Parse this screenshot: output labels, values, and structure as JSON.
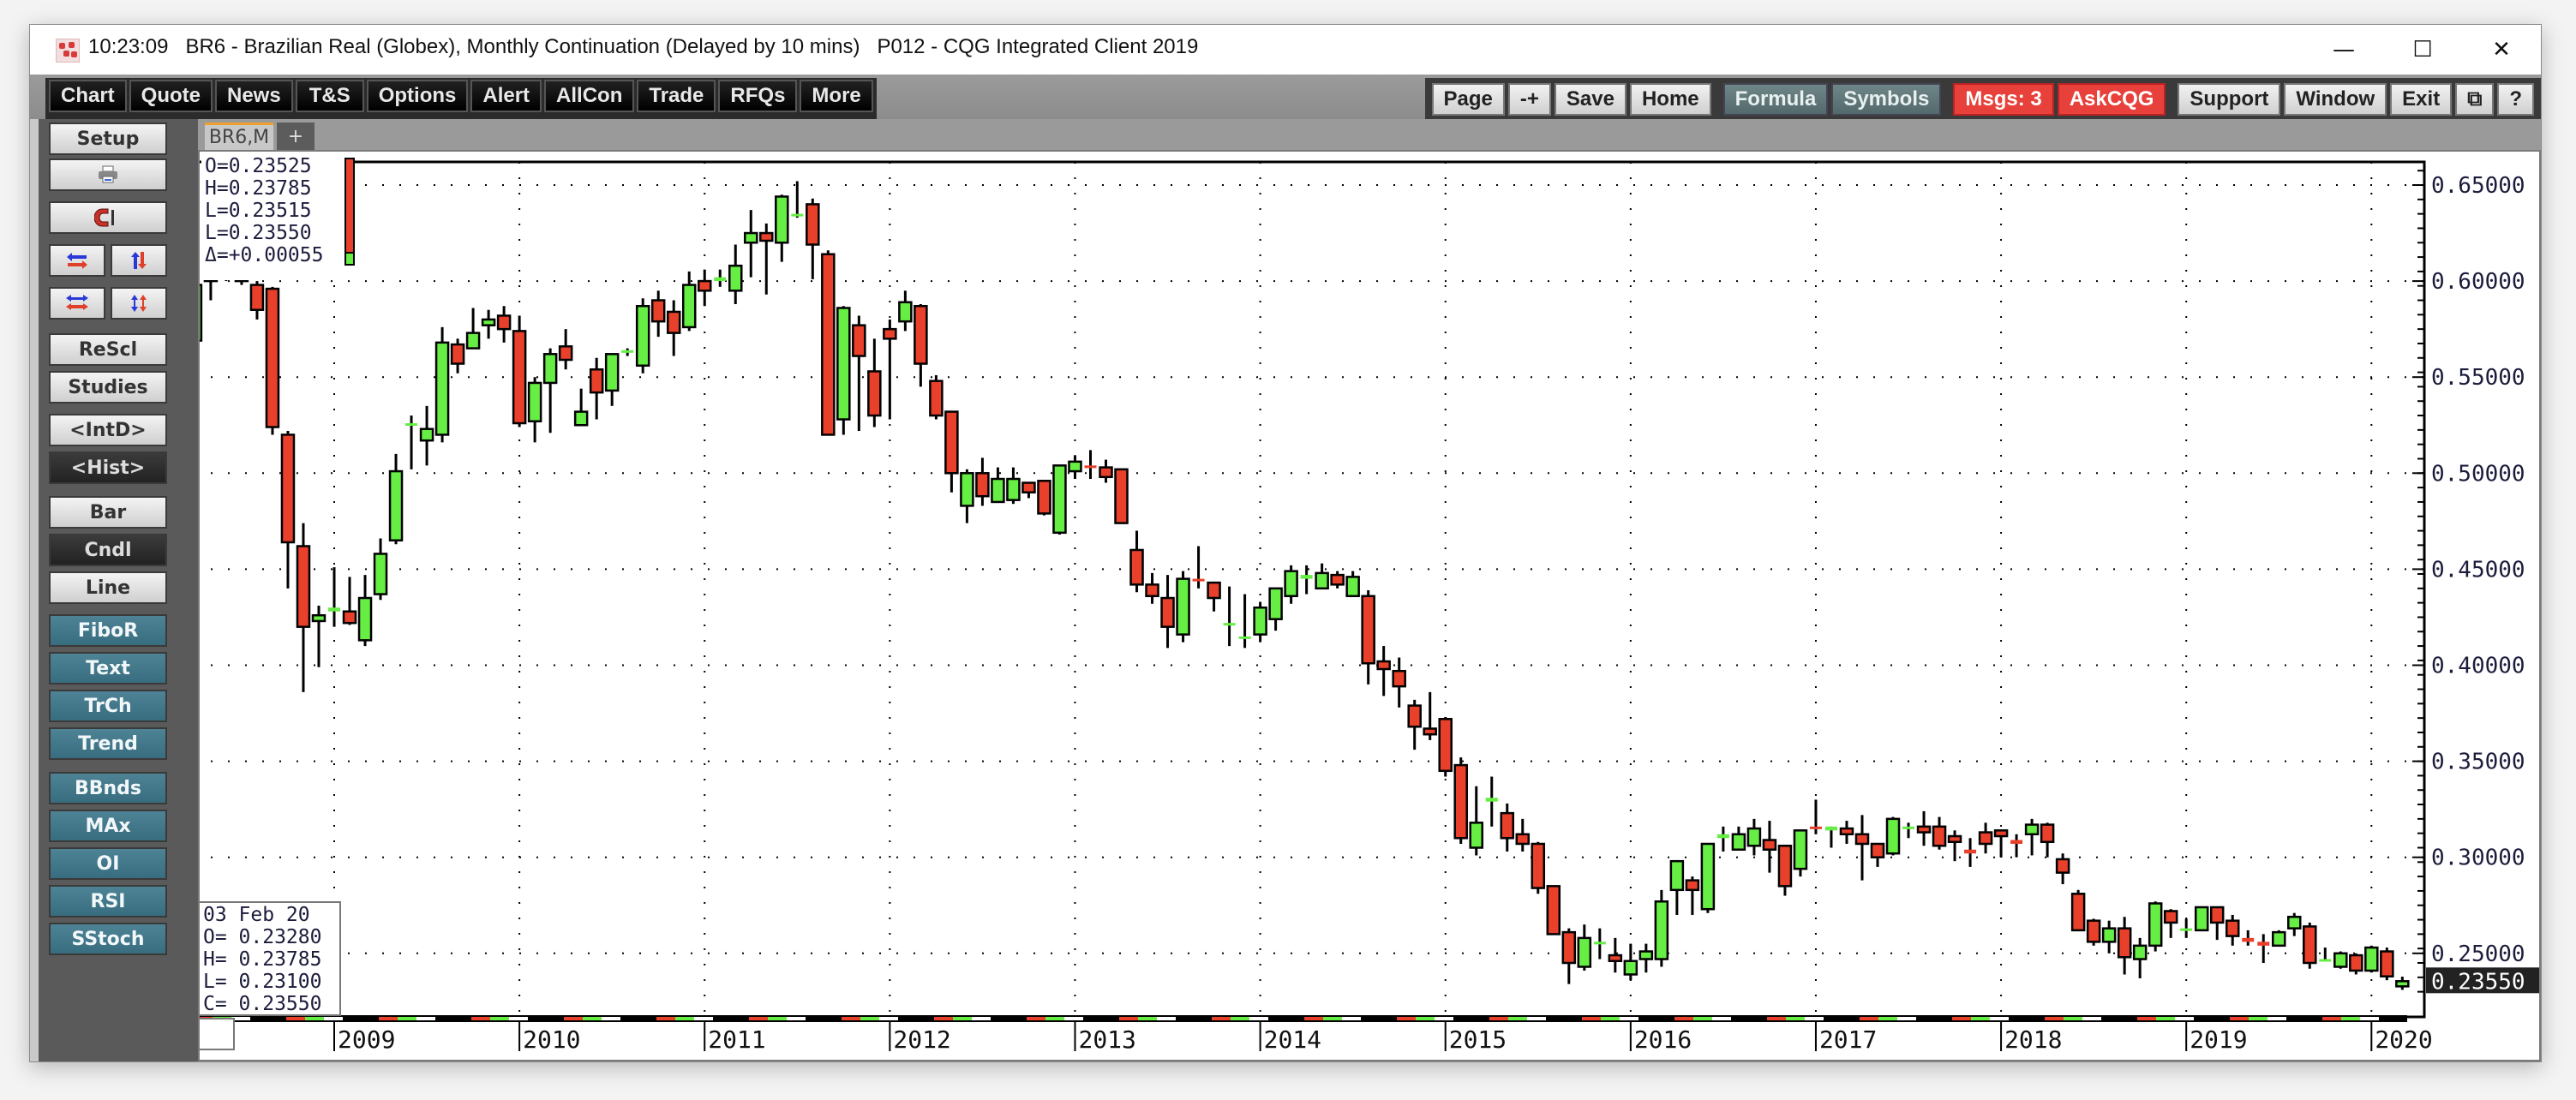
{
  "window": {
    "time": "10:23:09",
    "title": "BR6 - Brazilian Real (Globex), Monthly Continuation (Delayed by 10 mins)   P012 - CQG Integrated Client 2019",
    "controls": {
      "minimize": "—",
      "maximize": "☐",
      "close": "✕"
    }
  },
  "toolbar": {
    "left": [
      "Chart",
      "Quote",
      "News",
      "T&S",
      "Options",
      "Alert",
      "AllCon",
      "Trade",
      "RFQs",
      "More"
    ],
    "right": [
      {
        "label": "Page",
        "style": "light"
      },
      {
        "label": "-+",
        "style": "light"
      },
      {
        "label": "Save",
        "style": "light"
      },
      {
        "label": "Home",
        "style": "light"
      },
      {
        "label": "Formula",
        "style": "slate"
      },
      {
        "label": "Symbols",
        "style": "slate"
      },
      {
        "label": "Msgs: 3",
        "style": "red"
      },
      {
        "label": "AskCQG",
        "style": "red"
      },
      {
        "label": "Support",
        "style": "light"
      },
      {
        "label": "Window",
        "style": "light"
      },
      {
        "label": "Exit",
        "style": "light"
      },
      {
        "label": "⧉",
        "style": "light"
      },
      {
        "label": "?",
        "style": "light"
      }
    ]
  },
  "sidebar": {
    "setup": "Setup",
    "print_icon": "printer-icon",
    "magnet_icon": "magnet-icon",
    "icon_pairs": [
      [
        "scroll-horizontal-icon",
        "scroll-vertical-icon"
      ],
      [
        "compress-horizontal-icon",
        "compress-vertical-icon"
      ]
    ],
    "buttons": [
      {
        "label": "ReScl",
        "style": "light"
      },
      {
        "label": "Studies",
        "style": "light"
      },
      {
        "label": "<IntD>",
        "style": "light"
      },
      {
        "label": "<Hist>",
        "style": "dark"
      },
      {
        "label": "Bar",
        "style": "light"
      },
      {
        "label": "Cndl",
        "style": "dark"
      },
      {
        "label": "Line",
        "style": "light"
      },
      {
        "label": "FiboR",
        "style": "teal"
      },
      {
        "label": "Text",
        "style": "teal"
      },
      {
        "label": "TrCh",
        "style": "teal"
      },
      {
        "label": "Trend",
        "style": "teal"
      },
      {
        "label": "BBnds",
        "style": "teal"
      },
      {
        "label": "MAx",
        "style": "teal"
      },
      {
        "label": "OI",
        "style": "teal"
      },
      {
        "label": "RSI",
        "style": "teal"
      },
      {
        "label": "SStoch",
        "style": "teal"
      }
    ]
  },
  "tabs": {
    "active": "BR6,M",
    "add": "+"
  },
  "readout_top": [
    "O=0.23525",
    "H=0.23785",
    "L=0.23515",
    "L=0.23550",
    "Δ=+0.00055"
  ],
  "readout_bottom": [
    "03 Feb 20",
    "O= 0.23280",
    "H= 0.23785",
    "L= 0.23100",
    "C= 0.23550"
  ],
  "colors": {
    "up": "#66ee44",
    "down": "#e8402a",
    "last_price_bg": "#222222"
  },
  "chart_data": {
    "type": "candlestick",
    "title": "BR6 - Brazilian Real (Globex), Monthly Continuation",
    "xlabel": "",
    "ylabel": "",
    "ylim": [
      0.225,
      0.662
    ],
    "y_ticks": [
      "0.65000",
      "0.60000",
      "0.55000",
      "0.50000",
      "0.45000",
      "0.40000",
      "0.35000",
      "0.30000",
      "0.25000"
    ],
    "y_tick_values": [
      0.65,
      0.6,
      0.55,
      0.5,
      0.45,
      0.4,
      0.35,
      0.3,
      0.25
    ],
    "x_ticks": [
      "2009",
      "2010",
      "2011",
      "2012",
      "2013",
      "2014",
      "2015",
      "2016",
      "2017",
      "2018",
      "2019",
      "2020"
    ],
    "last_price": "0.23550",
    "last_price_value": 0.2355,
    "grid": "dotted",
    "start_month": "2008-03",
    "candles": [
      [
        0.59,
        0.602,
        0.568,
        0.569
      ],
      [
        0.569,
        0.6,
        0.568,
        0.598
      ],
      [
        0.6,
        0.606,
        0.59,
        0.608
      ],
      [
        0.608,
        0.612,
        0.6,
        0.605
      ],
      [
        0.605,
        0.61,
        0.598,
        0.6
      ],
      [
        0.598,
        0.6,
        0.58,
        0.585
      ],
      [
        0.596,
        0.597,
        0.52,
        0.524
      ],
      [
        0.52,
        0.522,
        0.44,
        0.464
      ],
      [
        0.462,
        0.474,
        0.386,
        0.42
      ],
      [
        0.423,
        0.431,
        0.399,
        0.426
      ],
      [
        0.428,
        0.451,
        0.42,
        0.43
      ],
      [
        0.428,
        0.446,
        0.421,
        0.422
      ],
      [
        0.413,
        0.447,
        0.41,
        0.435
      ],
      [
        0.437,
        0.466,
        0.434,
        0.458
      ],
      [
        0.465,
        0.51,
        0.463,
        0.501
      ],
      [
        0.526,
        0.53,
        0.502,
        0.526
      ],
      [
        0.517,
        0.535,
        0.504,
        0.523
      ],
      [
        0.52,
        0.576,
        0.516,
        0.568
      ],
      [
        0.567,
        0.57,
        0.552,
        0.557
      ],
      [
        0.565,
        0.586,
        0.565,
        0.573
      ],
      [
        0.577,
        0.585,
        0.57,
        0.58
      ],
      [
        0.582,
        0.587,
        0.568,
        0.575
      ],
      [
        0.574,
        0.582,
        0.524,
        0.526
      ],
      [
        0.527,
        0.55,
        0.516,
        0.547
      ],
      [
        0.547,
        0.565,
        0.521,
        0.562
      ],
      [
        0.566,
        0.575,
        0.554,
        0.559
      ],
      [
        0.525,
        0.544,
        0.526,
        0.532
      ],
      [
        0.554,
        0.56,
        0.528,
        0.542
      ],
      [
        0.543,
        0.562,
        0.535,
        0.562
      ],
      [
        0.563,
        0.565,
        0.561,
        0.564
      ],
      [
        0.556,
        0.591,
        0.552,
        0.587
      ],
      [
        0.59,
        0.595,
        0.571,
        0.579
      ],
      [
        0.584,
        0.59,
        0.561,
        0.573
      ],
      [
        0.576,
        0.605,
        0.574,
        0.598
      ],
      [
        0.6,
        0.606,
        0.587,
        0.595
      ],
      [
        0.6,
        0.606,
        0.597,
        0.602
      ],
      [
        0.595,
        0.619,
        0.588,
        0.608
      ],
      [
        0.62,
        0.637,
        0.602,
        0.625
      ],
      [
        0.625,
        0.63,
        0.593,
        0.621
      ],
      [
        0.62,
        0.645,
        0.61,
        0.644
      ],
      [
        0.635,
        0.652,
        0.633,
        0.635
      ],
      [
        0.64,
        0.643,
        0.601,
        0.619
      ],
      [
        0.614,
        0.616,
        0.523,
        0.52
      ],
      [
        0.528,
        0.587,
        0.52,
        0.586
      ],
      [
        0.577,
        0.582,
        0.522,
        0.561
      ],
      [
        0.553,
        0.57,
        0.524,
        0.53
      ],
      [
        0.575,
        0.58,
        0.528,
        0.57
      ],
      [
        0.579,
        0.595,
        0.574,
        0.589
      ],
      [
        0.587,
        0.588,
        0.545,
        0.557
      ],
      [
        0.548,
        0.551,
        0.528,
        0.53
      ],
      [
        0.532,
        0.532,
        0.49,
        0.5
      ],
      [
        0.483,
        0.502,
        0.474,
        0.5
      ],
      [
        0.5,
        0.508,
        0.483,
        0.488
      ],
      [
        0.485,
        0.503,
        0.486,
        0.497
      ],
      [
        0.486,
        0.503,
        0.484,
        0.497
      ],
      [
        0.495,
        0.495,
        0.487,
        0.49
      ],
      [
        0.496,
        0.496,
        0.478,
        0.479
      ],
      [
        0.469,
        0.499,
        0.468,
        0.504
      ],
      [
        0.501,
        0.509,
        0.497,
        0.506
      ],
      [
        0.504,
        0.512,
        0.497,
        0.503
      ],
      [
        0.503,
        0.507,
        0.495,
        0.498
      ],
      [
        0.502,
        0.494,
        0.478,
        0.474
      ],
      [
        0.46,
        0.47,
        0.438,
        0.442
      ],
      [
        0.442,
        0.448,
        0.432,
        0.436
      ],
      [
        0.435,
        0.447,
        0.409,
        0.42
      ],
      [
        0.416,
        0.449,
        0.412,
        0.445
      ],
      [
        0.445,
        0.462,
        0.44,
        0.444
      ],
      [
        0.443,
        0.44,
        0.428,
        0.435
      ],
      [
        0.421,
        0.441,
        0.41,
        0.422
      ],
      [
        0.414,
        0.437,
        0.409,
        0.415
      ],
      [
        0.416,
        0.433,
        0.412,
        0.43
      ],
      [
        0.424,
        0.435,
        0.418,
        0.44
      ],
      [
        0.436,
        0.452,
        0.432,
        0.449
      ],
      [
        0.445,
        0.452,
        0.437,
        0.447
      ],
      [
        0.44,
        0.453,
        0.44,
        0.448
      ],
      [
        0.447,
        0.449,
        0.44,
        0.442
      ],
      [
        0.436,
        0.449,
        0.439,
        0.446
      ],
      [
        0.436,
        0.439,
        0.39,
        0.401
      ],
      [
        0.402,
        0.41,
        0.384,
        0.398
      ],
      [
        0.397,
        0.404,
        0.378,
        0.389
      ],
      [
        0.379,
        0.382,
        0.356,
        0.368
      ],
      [
        0.367,
        0.386,
        0.361,
        0.364
      ],
      [
        0.372,
        0.373,
        0.342,
        0.345
      ],
      [
        0.348,
        0.352,
        0.307,
        0.31
      ],
      [
        0.305,
        0.337,
        0.301,
        0.318
      ],
      [
        0.329,
        0.342,
        0.316,
        0.331
      ],
      [
        0.323,
        0.328,
        0.303,
        0.31
      ],
      [
        0.312,
        0.32,
        0.303,
        0.307
      ],
      [
        0.307,
        0.308,
        0.281,
        0.284
      ],
      [
        0.285,
        0.284,
        0.27,
        0.26
      ],
      [
        0.261,
        0.263,
        0.234,
        0.245
      ],
      [
        0.243,
        0.265,
        0.241,
        0.258
      ],
      [
        0.255,
        0.263,
        0.247,
        0.256
      ],
      [
        0.249,
        0.258,
        0.24,
        0.246
      ],
      [
        0.239,
        0.255,
        0.236,
        0.246
      ],
      [
        0.247,
        0.255,
        0.24,
        0.251
      ],
      [
        0.247,
        0.283,
        0.243,
        0.277
      ],
      [
        0.283,
        0.294,
        0.27,
        0.298
      ],
      [
        0.288,
        0.29,
        0.27,
        0.283
      ],
      [
        0.273,
        0.307,
        0.271,
        0.307
      ],
      [
        0.31,
        0.316,
        0.303,
        0.312
      ],
      [
        0.304,
        0.316,
        0.305,
        0.312
      ],
      [
        0.306,
        0.32,
        0.301,
        0.315
      ],
      [
        0.309,
        0.319,
        0.292,
        0.304
      ],
      [
        0.306,
        0.3,
        0.28,
        0.285
      ],
      [
        0.294,
        0.313,
        0.29,
        0.314
      ],
      [
        0.316,
        0.33,
        0.312,
        0.315
      ],
      [
        0.314,
        0.313,
        0.305,
        0.316
      ],
      [
        0.315,
        0.319,
        0.307,
        0.312
      ],
      [
        0.312,
        0.322,
        0.288,
        0.307
      ],
      [
        0.307,
        0.307,
        0.295,
        0.3
      ],
      [
        0.302,
        0.321,
        0.301,
        0.32
      ],
      [
        0.316,
        0.318,
        0.31,
        0.316
      ],
      [
        0.316,
        0.324,
        0.306,
        0.313
      ],
      [
        0.316,
        0.321,
        0.304,
        0.306
      ],
      [
        0.311,
        0.314,
        0.298,
        0.308
      ],
      [
        0.304,
        0.31,
        0.295,
        0.302
      ],
      [
        0.313,
        0.318,
        0.302,
        0.307
      ],
      [
        0.314,
        0.312,
        0.3,
        0.311
      ],
      [
        0.309,
        0.312,
        0.3,
        0.307
      ],
      [
        0.312,
        0.32,
        0.301,
        0.317
      ],
      [
        0.317,
        0.318,
        0.3,
        0.308
      ],
      [
        0.299,
        0.302,
        0.286,
        0.292
      ],
      [
        0.281,
        0.283,
        0.264,
        0.262
      ],
      [
        0.267,
        0.268,
        0.254,
        0.256
      ],
      [
        0.256,
        0.267,
        0.25,
        0.263
      ],
      [
        0.263,
        0.269,
        0.239,
        0.248
      ],
      [
        0.247,
        0.258,
        0.237,
        0.254
      ],
      [
        0.254,
        0.277,
        0.251,
        0.276
      ],
      [
        0.272,
        0.273,
        0.258,
        0.266
      ],
      [
        0.263,
        0.268,
        0.258,
        0.263
      ],
      [
        0.262,
        0.271,
        0.262,
        0.274
      ],
      [
        0.274,
        0.271,
        0.257,
        0.266
      ],
      [
        0.267,
        0.27,
        0.254,
        0.259
      ],
      [
        0.258,
        0.262,
        0.254,
        0.256
      ],
      [
        0.256,
        0.26,
        0.245,
        0.254
      ],
      [
        0.254,
        0.262,
        0.254,
        0.261
      ],
      [
        0.263,
        0.271,
        0.259,
        0.269
      ],
      [
        0.264,
        0.266,
        0.242,
        0.245
      ],
      [
        0.247,
        0.253,
        0.246,
        0.247
      ],
      [
        0.243,
        0.251,
        0.242,
        0.25
      ],
      [
        0.249,
        0.25,
        0.239,
        0.241
      ],
      [
        0.241,
        0.254,
        0.24,
        0.253
      ],
      [
        0.251,
        0.253,
        0.236,
        0.238
      ],
      [
        0.2328,
        0.23785,
        0.231,
        0.2355
      ]
    ]
  }
}
